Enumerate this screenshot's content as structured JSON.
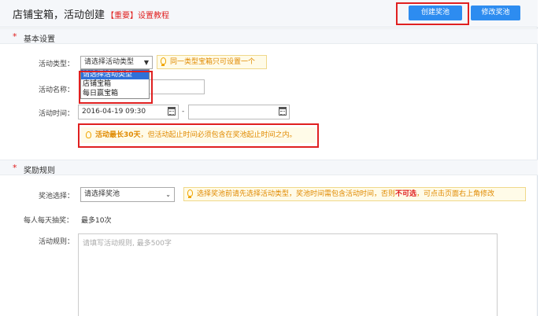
{
  "header": {
    "title": "店铺宝箱，活动创建",
    "tutorial_link": "【重要】设置教程",
    "create_pool_button": "创建奖池",
    "modify_pool_button": "修改奖池"
  },
  "basic_settings": {
    "required_mark": "*",
    "title": "基本设置",
    "activity_type": {
      "label": "活动类型：",
      "selected": "请选择活动类型",
      "tip": "同一类型宝箱只可设置一个",
      "options": [
        "请选择活动类型",
        "店铺宝箱",
        "每日赢宝箱"
      ]
    },
    "activity_name": {
      "label": "活动名称：",
      "value": ""
    },
    "activity_time": {
      "label": "活动时间：",
      "start": "2016-04-19 09:30",
      "separator": "-",
      "end": ""
    },
    "duration_tip": {
      "prefix": "活动最长30天",
      "rest": "，但活动起止时间必须包含在奖池起止时间之内。"
    }
  },
  "reward_rules": {
    "required_mark": "*",
    "title": "奖励规则",
    "pool_select": {
      "label": "奖池选择：",
      "selected": "请选择奖池",
      "tip_prefix": "选择奖池前请先选择活动类型，奖池时间需包含活动时间，否则",
      "tip_strong": "不可选",
      "tip_suffix": "，可点击页面右上角修改"
    },
    "daily_draw": {
      "label": "每人每天抽奖：",
      "value": "最多10次"
    },
    "rules": {
      "label": "活动规则：",
      "placeholder": "请填写活动规则, 最多500字"
    }
  }
}
